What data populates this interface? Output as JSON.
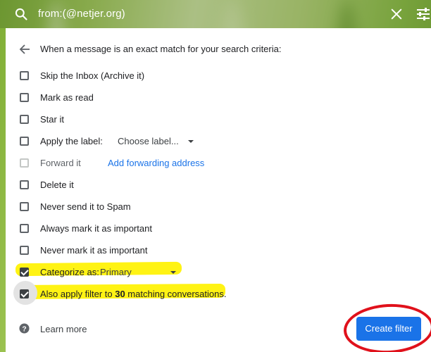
{
  "search": {
    "query": "from:(@netjer.org)"
  },
  "filter_panel": {
    "header": "When a message is an exact match for your search criteria:",
    "options": [
      {
        "label": "Skip the Inbox (Archive it)",
        "checked": false
      },
      {
        "label": "Mark as read",
        "checked": false
      },
      {
        "label": "Star it",
        "checked": false
      },
      {
        "label": "Apply the label:",
        "checked": false,
        "select_value": "Choose label..."
      },
      {
        "label": "Forward it",
        "checked": false,
        "disabled": true,
        "link": "Add forwarding address"
      },
      {
        "label": "Delete it",
        "checked": false
      },
      {
        "label": "Never send it to Spam",
        "checked": false
      },
      {
        "label": "Always mark it as important",
        "checked": false
      },
      {
        "label": "Never mark it as important",
        "checked": false
      },
      {
        "label": "Categorize as:",
        "checked": true,
        "select_value": "Primary"
      }
    ],
    "apply_existing": {
      "prefix": "Also apply filter to ",
      "count": "30",
      "suffix": " matching conversations.",
      "checked": true
    },
    "learn_more": "Learn more",
    "create_button": "Create filter"
  },
  "colors": {
    "accent_blue": "#1a73e8",
    "highlight_yellow": "#fff200",
    "annotation_red": "#e0111b"
  },
  "icons": [
    "search-icon",
    "close-icon",
    "tune-icon",
    "arrow-back-icon",
    "help-icon",
    "dropdown-caret-icon"
  ]
}
